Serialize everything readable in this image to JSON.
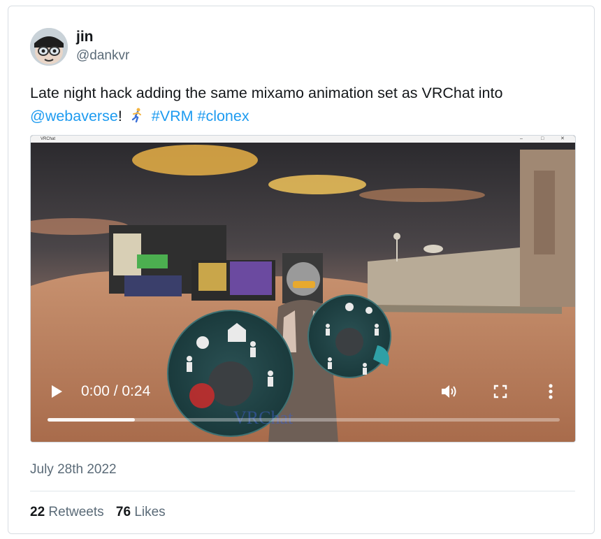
{
  "author": {
    "name": "jin",
    "handle": "@dankvr"
  },
  "tweet": {
    "text_before": "Late night hack adding the same mixamo animation set as VRChat into",
    "mention": "@webaverse",
    "after_mention": "!",
    "emoji": "person-running",
    "hashtag_1": "#VRM",
    "hashtag_2": "#clonex"
  },
  "video": {
    "window_title": "VRChat",
    "time_display": "0:00 / 0:24",
    "progress": 0.17,
    "watermark": "VRChat"
  },
  "meta": {
    "date": "July 28th 2022",
    "retweets_count": "22",
    "retweets_label": "Retweets",
    "likes_count": "76",
    "likes_label": "Likes"
  },
  "colors": {
    "link": "#1d9bf0",
    "muted": "#5b6b78",
    "menu_teal": "#1f4a4c"
  }
}
